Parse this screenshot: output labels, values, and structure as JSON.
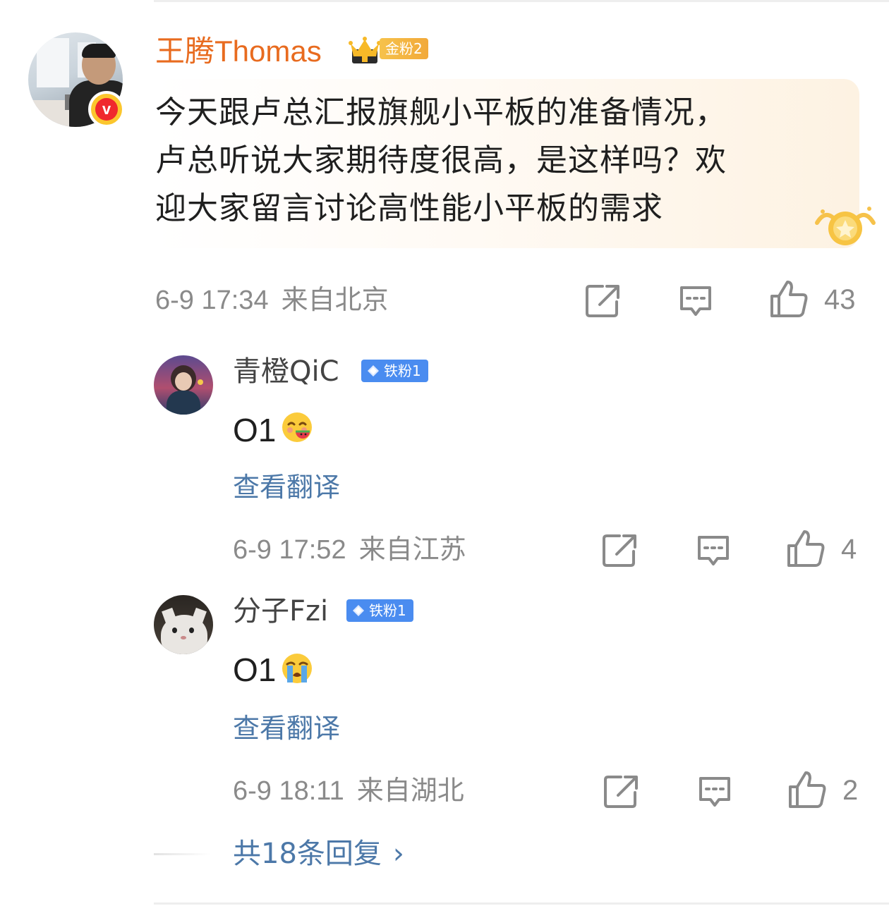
{
  "main_comment": {
    "author": "王腾Thomas",
    "fan_badge": "金粉2",
    "text_lines": [
      "今天跟卢总汇报旗舰小平板的准备情况，",
      "卢总听说大家期待度很高，是这样吗？欢",
      "迎大家留言讨论高性能小平板的需求"
    ],
    "time": "6-9 17:34",
    "location": "来自北京",
    "likes": "43",
    "verified_icon": "v-verified-badge"
  },
  "replies": [
    {
      "author": "青橙QiC",
      "fan_badge": "铁粉1",
      "text": "O1",
      "emoji": "watermelon-smile-emoji",
      "translate": "查看翻译",
      "time": "6-9 17:52",
      "location": "来自江苏",
      "likes": "4"
    },
    {
      "author": "分子Fzi",
      "fan_badge": "铁粉1",
      "text": "O1",
      "emoji": "crying-emoji",
      "translate": "查看翻译",
      "time": "6-9 18:11",
      "location": "来自湖北",
      "likes": "2"
    }
  ],
  "more_replies": "共18条回复",
  "icons": {
    "share": "share-icon",
    "comment": "comment-icon",
    "like": "thumbs-up-icon",
    "chevron": "chevron-right-icon"
  },
  "colors": {
    "author_main": "#e86b1f",
    "link_blue": "#4c78a8",
    "meta_gray": "#8a8a8a",
    "iron_badge": "#4a8cf0",
    "gold_badge": "#f2a93a"
  }
}
